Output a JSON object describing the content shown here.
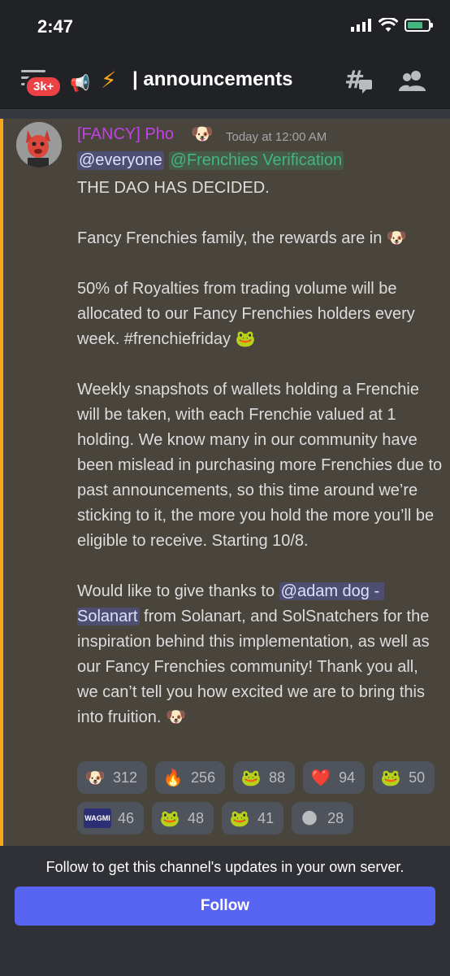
{
  "status_bar": {
    "time": "2:47",
    "battery_level": 0.75
  },
  "header": {
    "badge": "3k+",
    "channel": "announcements",
    "icons": [
      "menu-icon",
      "megaphone-icon",
      "bolt-icon",
      "threads-icon",
      "members-icon"
    ]
  },
  "message": {
    "author": "[FANCY] Pho",
    "author_emoji": "🐶",
    "timestamp": "Today at 12:00 AM",
    "mention_everyone": "@everyone",
    "mention_role": "@Frenchies Verification",
    "paragraphs": {
      "p1": "THE DAO HAS DECIDED.",
      "p2": "Fancy Frenchies family, the rewards are in 🐶",
      "p3": "50% of Royalties from trading volume will be allocated to our Fancy Frenchies holders every week. #frenchiefriday 🐸",
      "p4": "Weekly snapshots of wallets holding a Frenchie will be taken, with each Frenchie valued at 1 holding. We know many in our community have been mislead in purchasing more Frenchies due to past announcements, so this time around we’re sticking to it, the more you hold the more you’ll be eligible to receive. Starting 10/8.",
      "p5_before": "Would like to give thanks to ",
      "p5_mention": "@adam dog - Solanart",
      "p5_after": " from Solanart, and SolSnatchers for the inspiration behind this implementation, as well as our Fancy Frenchies community! Thank you all, we can’t tell you how excited we are to bring this into fruition. 🐶"
    },
    "reactions": [
      {
        "emoji": "🐶",
        "count": "312"
      },
      {
        "emoji": "🔥",
        "count": "256"
      },
      {
        "emoji": "🐸",
        "count": "88"
      },
      {
        "emoji": "❤️",
        "count": "94"
      },
      {
        "emoji": "🐸",
        "count": "50"
      },
      {
        "emoji": "WAGMI",
        "count": "46"
      },
      {
        "emoji": "🐸",
        "count": "48"
      },
      {
        "emoji": "🐸",
        "count": "41"
      },
      {
        "emoji": "🌑",
        "count": "28"
      }
    ]
  },
  "follow": {
    "text": "Follow to get this channel's updates in your own server.",
    "button": "Follow"
  },
  "colors": {
    "accent": "#5865f2",
    "author": "#c142e6",
    "highlight_bar": "#faa61a",
    "role": "#43b581"
  }
}
